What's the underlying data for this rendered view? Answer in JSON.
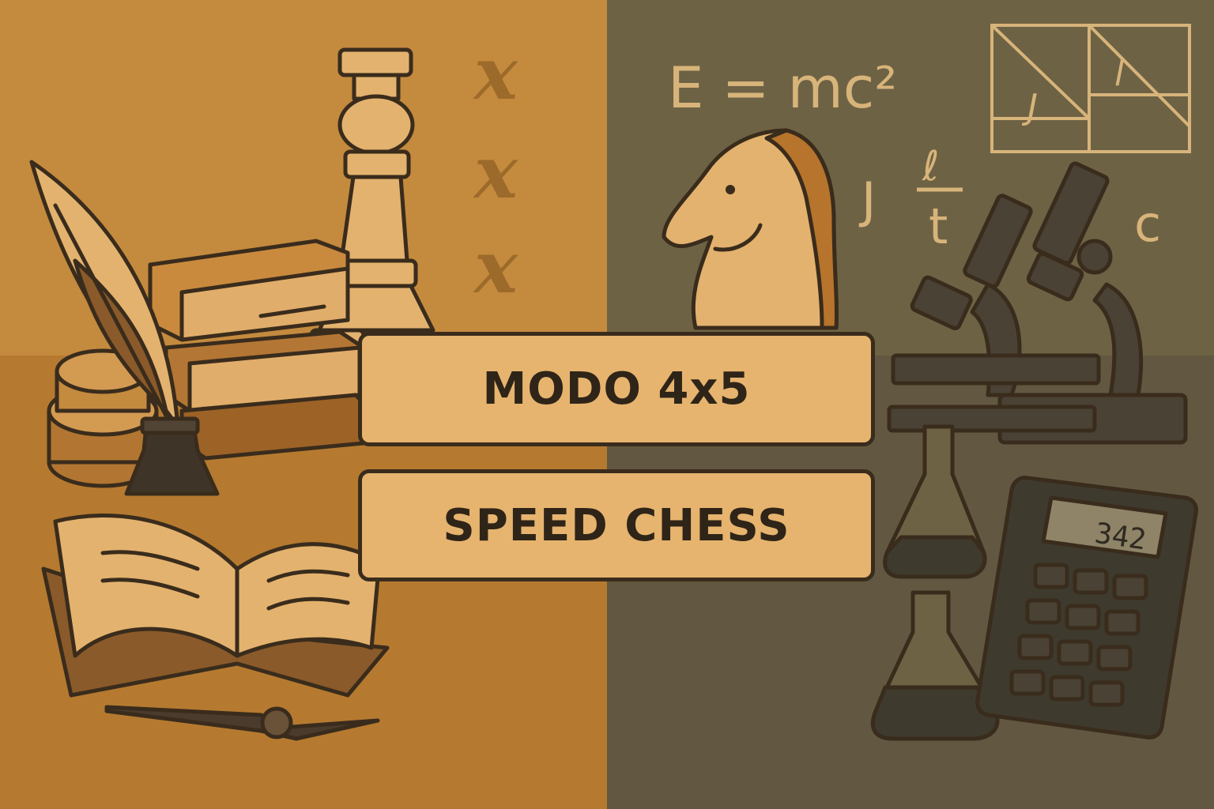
{
  "menu": {
    "mode_button": {
      "label": "MODO 4x5"
    },
    "speed_chess_button": {
      "label": "SPEED CHESS"
    }
  },
  "background": {
    "left_decor": {
      "letters": [
        "x",
        "x",
        "x"
      ]
    },
    "right_decor": {
      "equation": "E = mc²",
      "symbols": [
        "J",
        "ℓ",
        "t",
        "c"
      ],
      "diagram_letters": [
        "J",
        "l"
      ],
      "calculator_display": "342"
    }
  },
  "colors": {
    "left_bg": "#c48a3e",
    "right_bg": "#6e6245",
    "button_fill": "#e6b46e",
    "outline": "#3a2c1c"
  }
}
